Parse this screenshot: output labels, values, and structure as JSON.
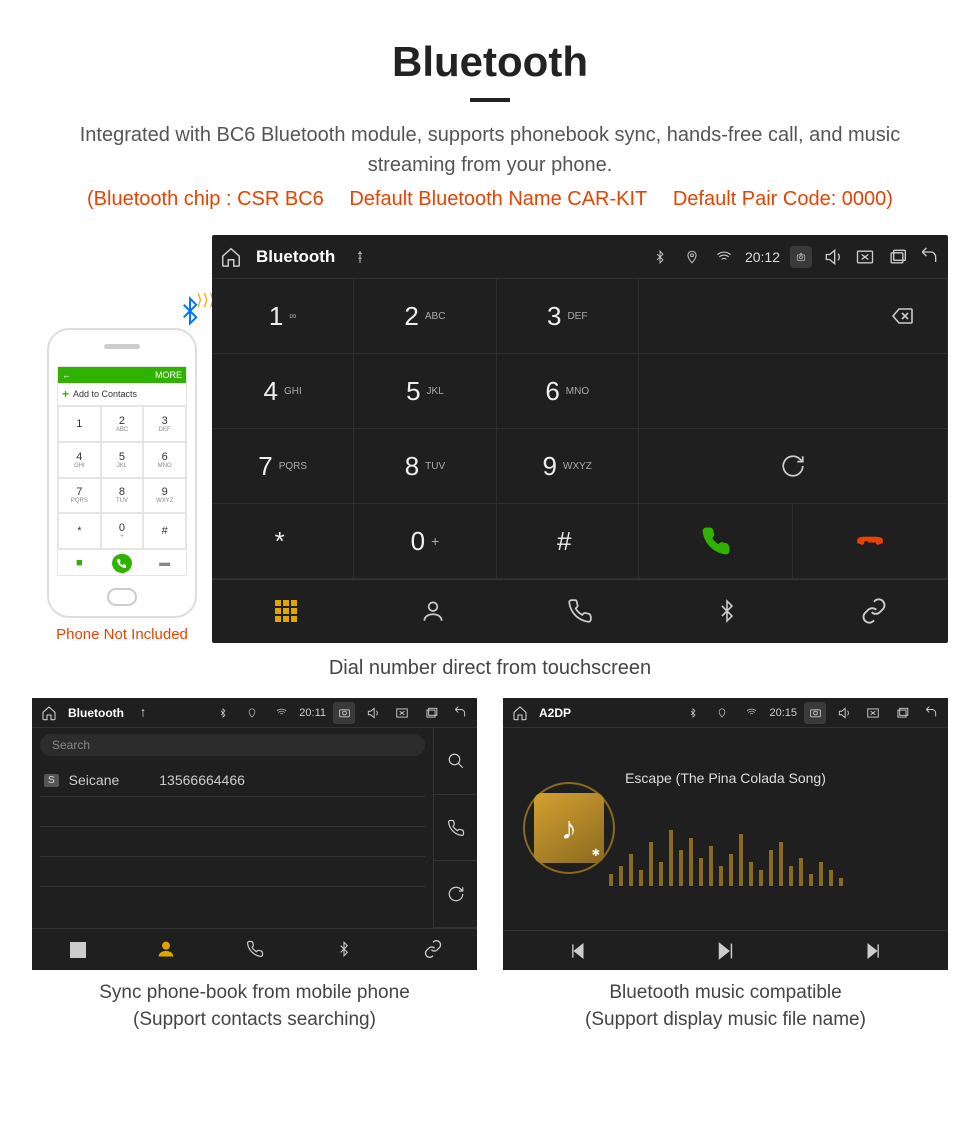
{
  "title": "Bluetooth",
  "subtitle": "Integrated with BC6 Bluetooth module, supports phonebook sync, hands-free call, and music streaming from your phone.",
  "specs": {
    "chip": "(Bluetooth chip : CSR BC6",
    "name": "Default Bluetooth Name CAR-KIT",
    "code": "Default Pair Code: 0000)"
  },
  "phone_mock": {
    "header_back": "←",
    "header_more": "MORE",
    "add_contacts": "Add to Contacts",
    "keys": [
      {
        "n": "1",
        "l": ""
      },
      {
        "n": "2",
        "l": "ABC"
      },
      {
        "n": "3",
        "l": "DEF"
      },
      {
        "n": "4",
        "l": "GHI"
      },
      {
        "n": "5",
        "l": "JKL"
      },
      {
        "n": "6",
        "l": "MNO"
      },
      {
        "n": "7",
        "l": "PQRS"
      },
      {
        "n": "8",
        "l": "TUV"
      },
      {
        "n": "9",
        "l": "WXYZ"
      },
      {
        "n": "*",
        "l": ""
      },
      {
        "n": "0",
        "l": "+"
      },
      {
        "n": "#",
        "l": ""
      }
    ],
    "note": "Phone Not Included"
  },
  "main": {
    "header_title": "Bluetooth",
    "time": "20:12",
    "keys": [
      {
        "n": "1",
        "l": "∞"
      },
      {
        "n": "2",
        "l": "ABC"
      },
      {
        "n": "3",
        "l": "DEF"
      },
      {
        "n": "4",
        "l": "GHI"
      },
      {
        "n": "5",
        "l": "JKL"
      },
      {
        "n": "6",
        "l": "MNO"
      },
      {
        "n": "7",
        "l": "PQRS"
      },
      {
        "n": "8",
        "l": "TUV"
      },
      {
        "n": "9",
        "l": "WXYZ"
      },
      {
        "n": "*",
        "l": ""
      },
      {
        "n": "0",
        "l": "+"
      },
      {
        "n": "#",
        "l": ""
      }
    ],
    "caption": "Dial number direct from touchscreen"
  },
  "screen2": {
    "header_title": "Bluetooth",
    "time": "20:11",
    "search_placeholder": "Search",
    "contact_badge": "S",
    "contact_name": "Seicane",
    "contact_number": "13566664466",
    "caption_l1": "Sync phone-book from mobile phone",
    "caption_l2": "(Support contacts searching)"
  },
  "screen3": {
    "header_title": "A2DP",
    "time": "20:15",
    "song": "Escape (The Pina Colada Song)",
    "caption_l1": "Bluetooth music compatible",
    "caption_l2": "(Support display music file name)"
  }
}
